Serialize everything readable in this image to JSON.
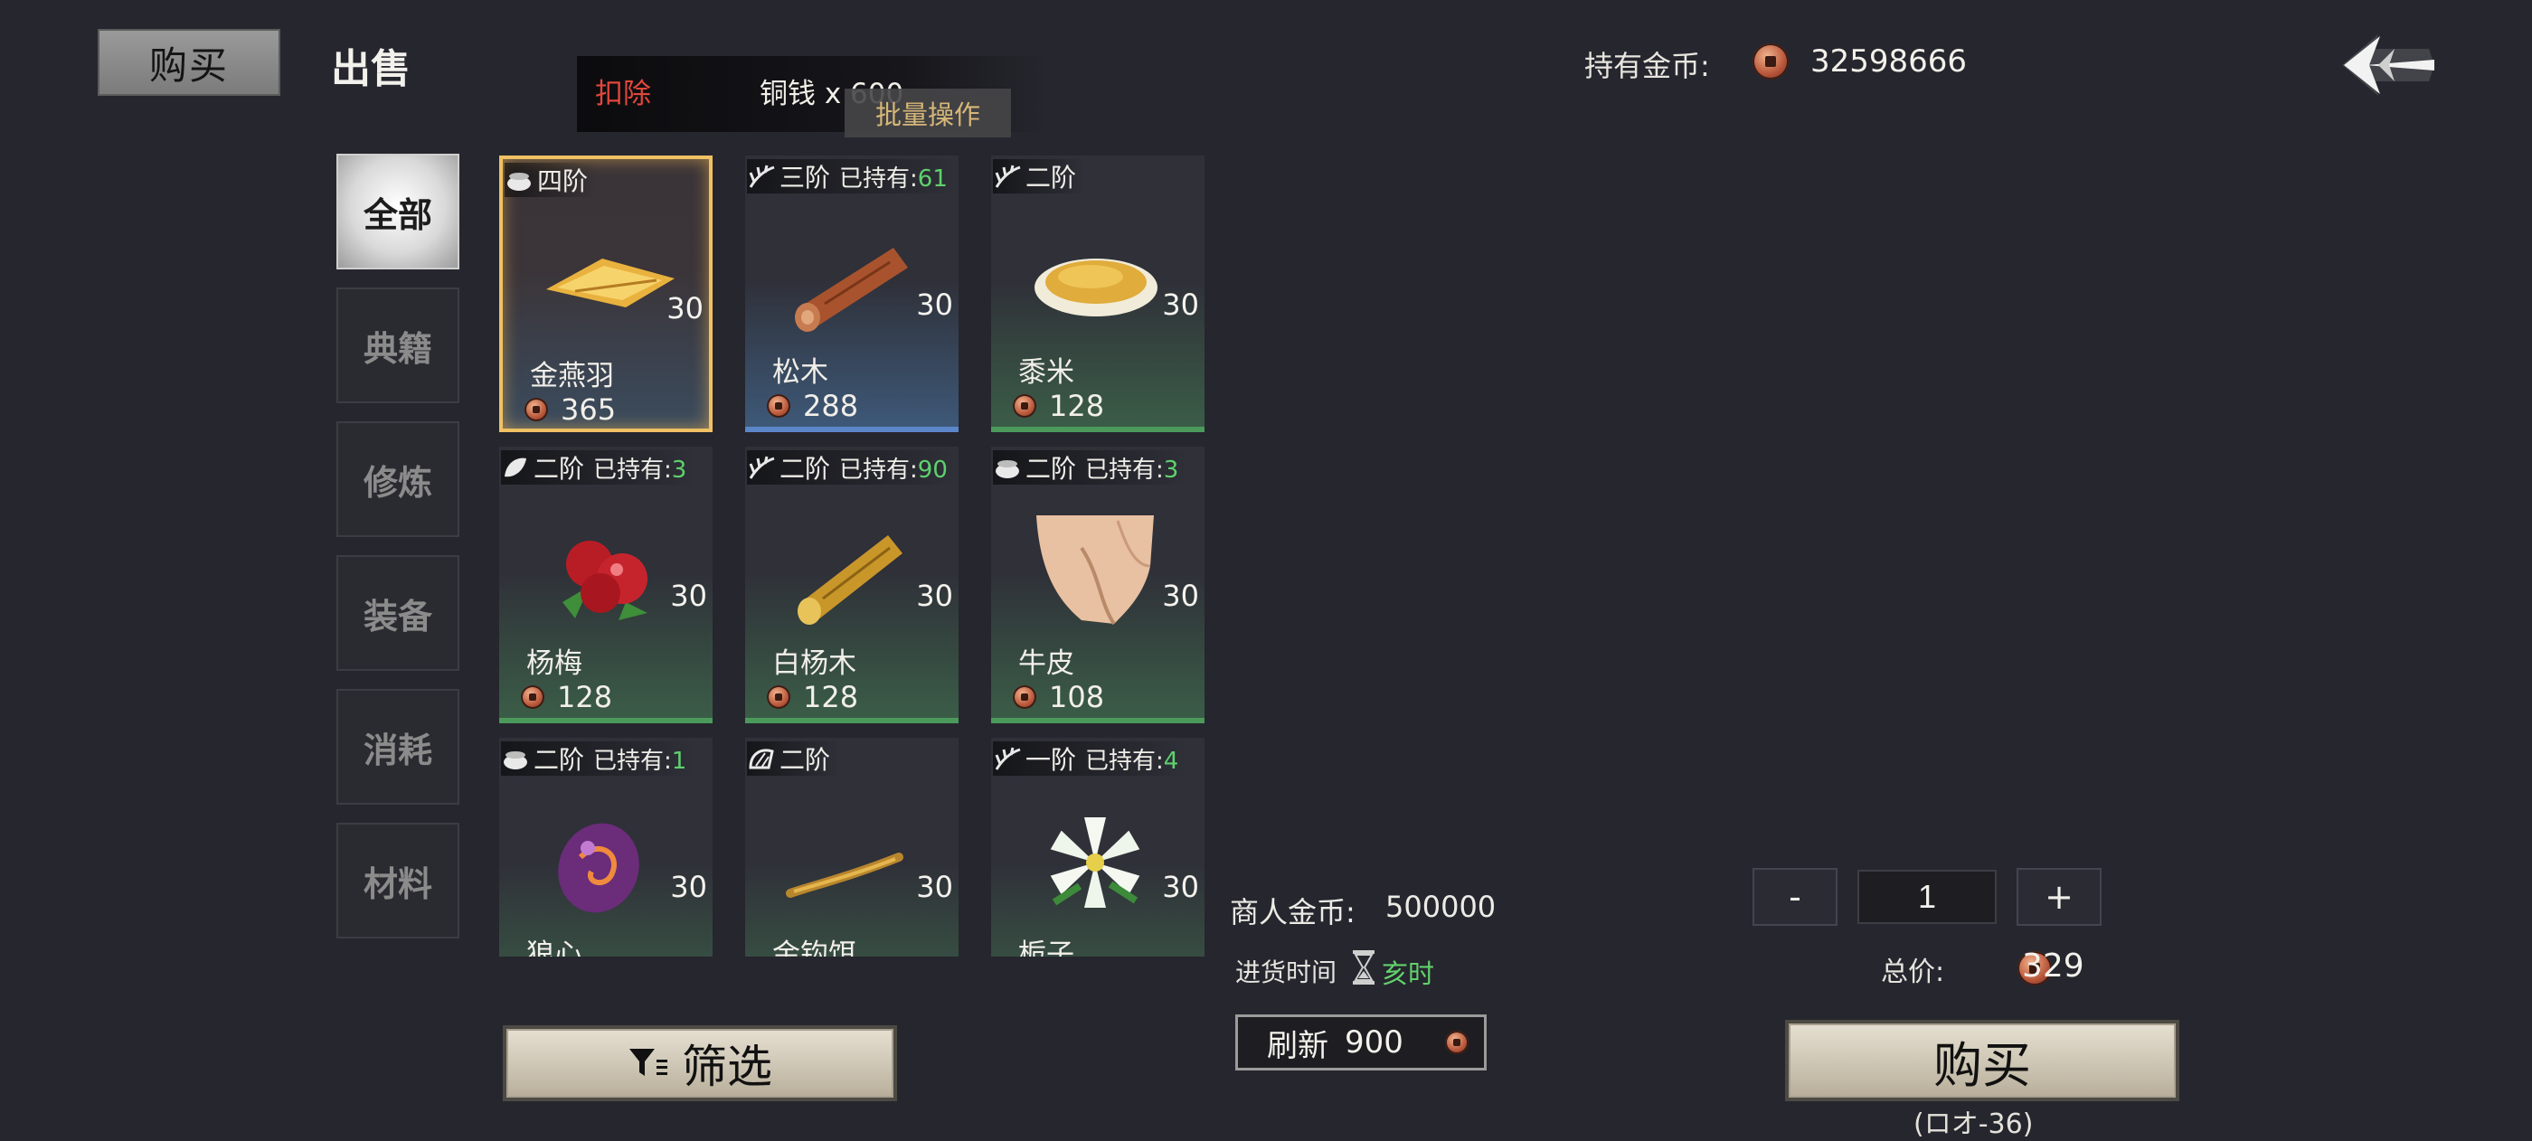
{
  "tabs": {
    "buy": "购买",
    "sell": "出售"
  },
  "notice": {
    "deduct": "扣除",
    "amount": "铜钱 x 600",
    "batch": "批量操作"
  },
  "gold": {
    "label": "持有金币:",
    "value": "32598666",
    "icon": "copper-coin-icon"
  },
  "categories": [
    "全部",
    "典籍",
    "修炼",
    "装备",
    "消耗",
    "材料"
  ],
  "items": [
    {
      "tier": "四阶",
      "owned": "",
      "owned_count": "",
      "qty": "30",
      "name": "金燕羽",
      "price": "365",
      "style": "selected",
      "icon": "gold-feather-icon"
    },
    {
      "tier": "三阶",
      "owned": "已持有:",
      "owned_count": "61",
      "qty": "30",
      "name": "松木",
      "price": "288",
      "style": "blue",
      "icon": "pine-log-icon"
    },
    {
      "tier": "二阶",
      "owned": "",
      "owned_count": "",
      "qty": "30",
      "name": "黍米",
      "price": "128",
      "style": "green",
      "icon": "millet-plate-icon"
    },
    {
      "tier": "二阶",
      "owned": "已持有:",
      "owned_count": "3",
      "qty": "30",
      "name": "杨梅",
      "price": "128",
      "style": "green",
      "icon": "bayberry-icon"
    },
    {
      "tier": "二阶",
      "owned": "已持有:",
      "owned_count": "90",
      "qty": "30",
      "name": "白杨木",
      "price": "128",
      "style": "green",
      "icon": "poplar-log-icon"
    },
    {
      "tier": "二阶",
      "owned": "已持有:",
      "owned_count": "3",
      "qty": "30",
      "name": "牛皮",
      "price": "108",
      "style": "green",
      "icon": "cowhide-icon"
    },
    {
      "tier": "二阶",
      "owned": "已持有:",
      "owned_count": "1",
      "qty": "30",
      "name": "狼心",
      "price": "",
      "style": "green",
      "icon": "wolf-heart-icon"
    },
    {
      "tier": "二阶",
      "owned": "",
      "owned_count": "",
      "qty": "30",
      "name": "金钩饵",
      "price": "",
      "style": "green",
      "icon": "golden-hook-bait-icon"
    },
    {
      "tier": "一阶",
      "owned": "已持有:",
      "owned_count": "4",
      "qty": "30",
      "name": "栀子",
      "price": "",
      "style": "green",
      "icon": "gardenia-icon"
    }
  ],
  "merchant": {
    "gold_label": "商人金币:",
    "gold_value": "500000",
    "restock_label": "进货时间",
    "restock_time": "亥时"
  },
  "refresh": {
    "label": "刷新",
    "cost": "900"
  },
  "stepper": {
    "minus": "-",
    "value": "1",
    "plus": "+"
  },
  "total": {
    "label": "总价:",
    "value": "329"
  },
  "filter_label": "筛选",
  "buy": {
    "label": "购买",
    "sub": "(ロオ-36)"
  }
}
